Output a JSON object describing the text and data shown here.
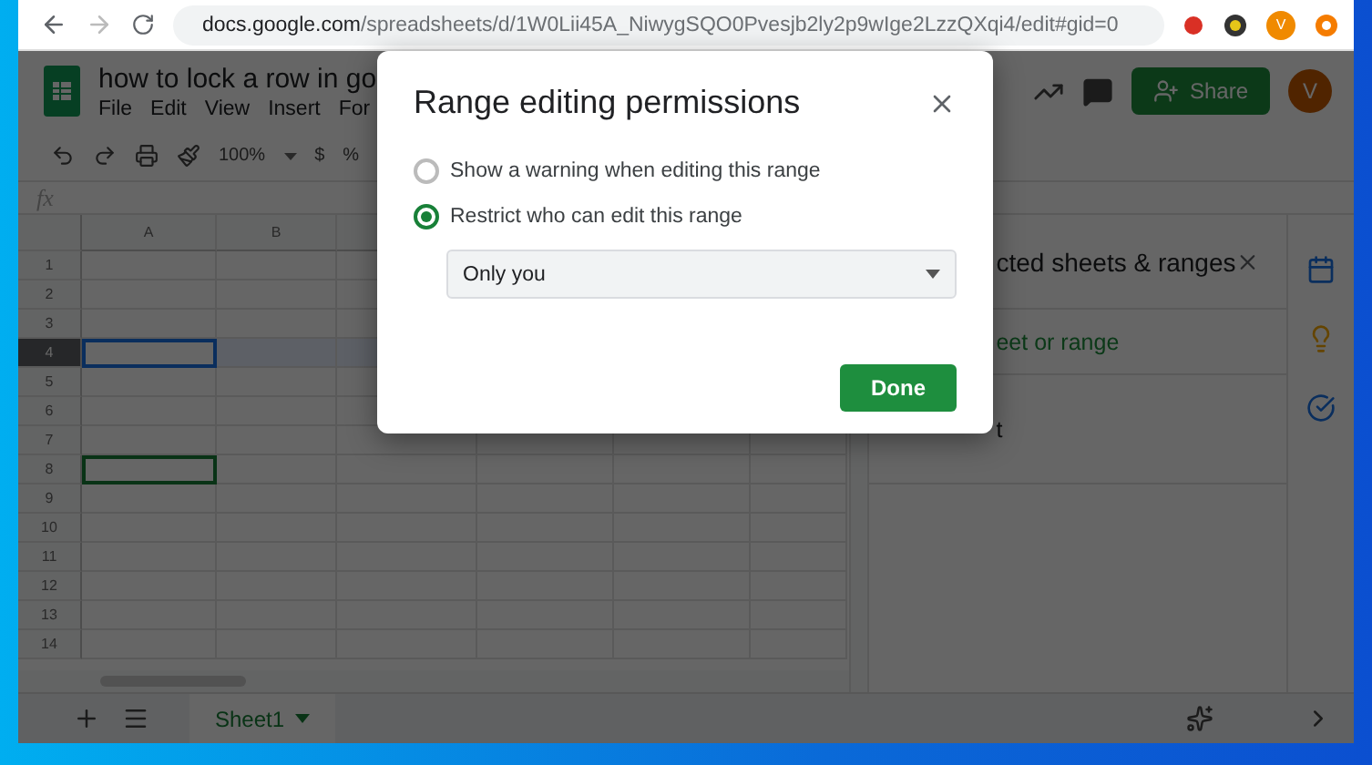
{
  "browser": {
    "url_host": "docs.google.com",
    "url_path": "/spreadsheets/d/1W0Lii45A_NiwygSQO0Pvesjb2ly2p9wIge2LzzQXqi4/edit#gid=0",
    "profile_initial": "V"
  },
  "doc": {
    "title": "how to lock a row in go",
    "menus": [
      "File",
      "Edit",
      "View",
      "Insert",
      "For"
    ],
    "share": "Share",
    "avatar_initial": "V"
  },
  "toolbar": {
    "zoom": "100%",
    "currency": "$",
    "percent": "%"
  },
  "formula_bar": {
    "label": "fx"
  },
  "grid": {
    "columns": [
      "A",
      "B"
    ],
    "rows": [
      {
        "label": "1",
        "selected": false,
        "collaborator_cursor": false
      },
      {
        "label": "2",
        "selected": false,
        "collaborator_cursor": false
      },
      {
        "label": "3",
        "selected": false,
        "collaborator_cursor": false
      },
      {
        "label": "4",
        "selected": true,
        "collaborator_cursor": false
      },
      {
        "label": "5",
        "selected": false,
        "collaborator_cursor": false
      },
      {
        "label": "6",
        "selected": false,
        "collaborator_cursor": false
      },
      {
        "label": "7",
        "selected": false,
        "collaborator_cursor": false
      },
      {
        "label": "8",
        "selected": false,
        "collaborator_cursor": true
      },
      {
        "label": "9",
        "selected": false,
        "collaborator_cursor": false
      },
      {
        "label": "10",
        "selected": false,
        "collaborator_cursor": false
      },
      {
        "label": "11",
        "selected": false,
        "collaborator_cursor": false
      },
      {
        "label": "12",
        "selected": false,
        "collaborator_cursor": false
      },
      {
        "label": "13",
        "selected": false,
        "collaborator_cursor": false
      },
      {
        "label": "14",
        "selected": false,
        "collaborator_cursor": false
      }
    ]
  },
  "panel": {
    "title": "cted sheets & ranges",
    "add": "eet or range",
    "items": [
      "t"
    ]
  },
  "dialog": {
    "title": "Range editing permissions",
    "options": [
      {
        "label": "Show a warning when editing this range",
        "selected": false
      },
      {
        "label": "Restrict who can edit this range",
        "selected": true
      }
    ],
    "dropdown": "Only you",
    "done": "Done"
  },
  "sheets": [
    {
      "name": "Sheet1",
      "selected": true
    }
  ]
}
